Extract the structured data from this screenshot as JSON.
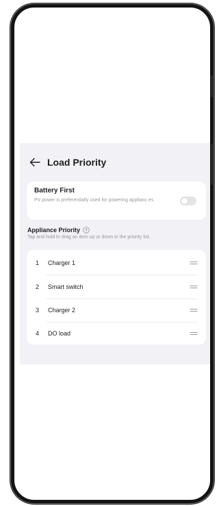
{
  "header": {
    "title": "Load Priority"
  },
  "battery_first": {
    "title": "Battery First",
    "description": "PV power is preferentially used for powering applianc es",
    "enabled": false
  },
  "appliance_priority": {
    "title": "Appliance Priority",
    "subtitle": "Tap and hold to drag an item up or down in the priority list.",
    "items": [
      {
        "index": "1",
        "label": "Charger 1"
      },
      {
        "index": "2",
        "label": "Smart switch"
      },
      {
        "index": "3",
        "label": "Charger 2"
      },
      {
        "index": "4",
        "label": "DO load"
      }
    ]
  },
  "colors": {
    "screen_bg": "#f1f1f6",
    "card_bg": "#ffffff",
    "text_primary": "#1e1e1e",
    "text_secondary": "#9a9a9a",
    "toggle_off": "#e4e4e8"
  },
  "icons": {
    "back": "arrow-left-icon",
    "info": "question-circle-icon",
    "drag": "drag-handle-icon"
  }
}
